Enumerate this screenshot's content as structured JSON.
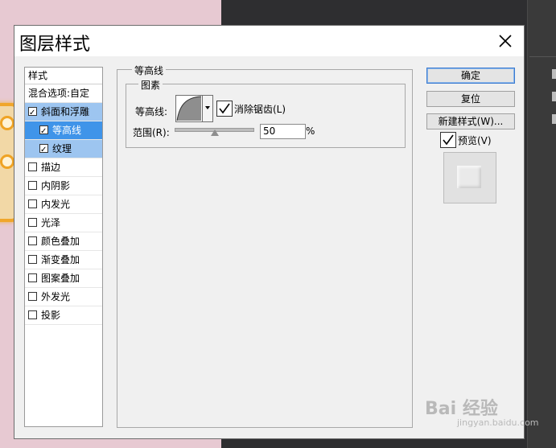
{
  "dialog": {
    "title": "图层样式"
  },
  "style_list": {
    "header": "样式",
    "blend_options": "混合选项:自定",
    "items": [
      {
        "label": "斜面和浮雕",
        "checked": true
      },
      {
        "label": "等高线",
        "checked": true
      },
      {
        "label": "纹理",
        "checked": true
      },
      {
        "label": "描边",
        "checked": false
      },
      {
        "label": "内阴影",
        "checked": false
      },
      {
        "label": "内发光",
        "checked": false
      },
      {
        "label": "光泽",
        "checked": false
      },
      {
        "label": "颜色叠加",
        "checked": false
      },
      {
        "label": "渐变叠加",
        "checked": false
      },
      {
        "label": "图案叠加",
        "checked": false
      },
      {
        "label": "外发光",
        "checked": false
      },
      {
        "label": "投影",
        "checked": false
      }
    ]
  },
  "contour_panel": {
    "group_title": "等高线",
    "subgroup_title": "图素",
    "contour_label": "等高线:",
    "antialias_label": "消除锯齿(L)",
    "antialias_checked": true,
    "range_label": "范围(R):",
    "range_value": "50",
    "range_unit": "%"
  },
  "buttons": {
    "ok": "确定",
    "reset": "复位",
    "new_style": "新建样式(W)...",
    "preview_label": "预览(V)",
    "preview_checked": true
  },
  "watermark": {
    "text": "Bai 经验",
    "sub": "jingyan.baidu.com"
  }
}
